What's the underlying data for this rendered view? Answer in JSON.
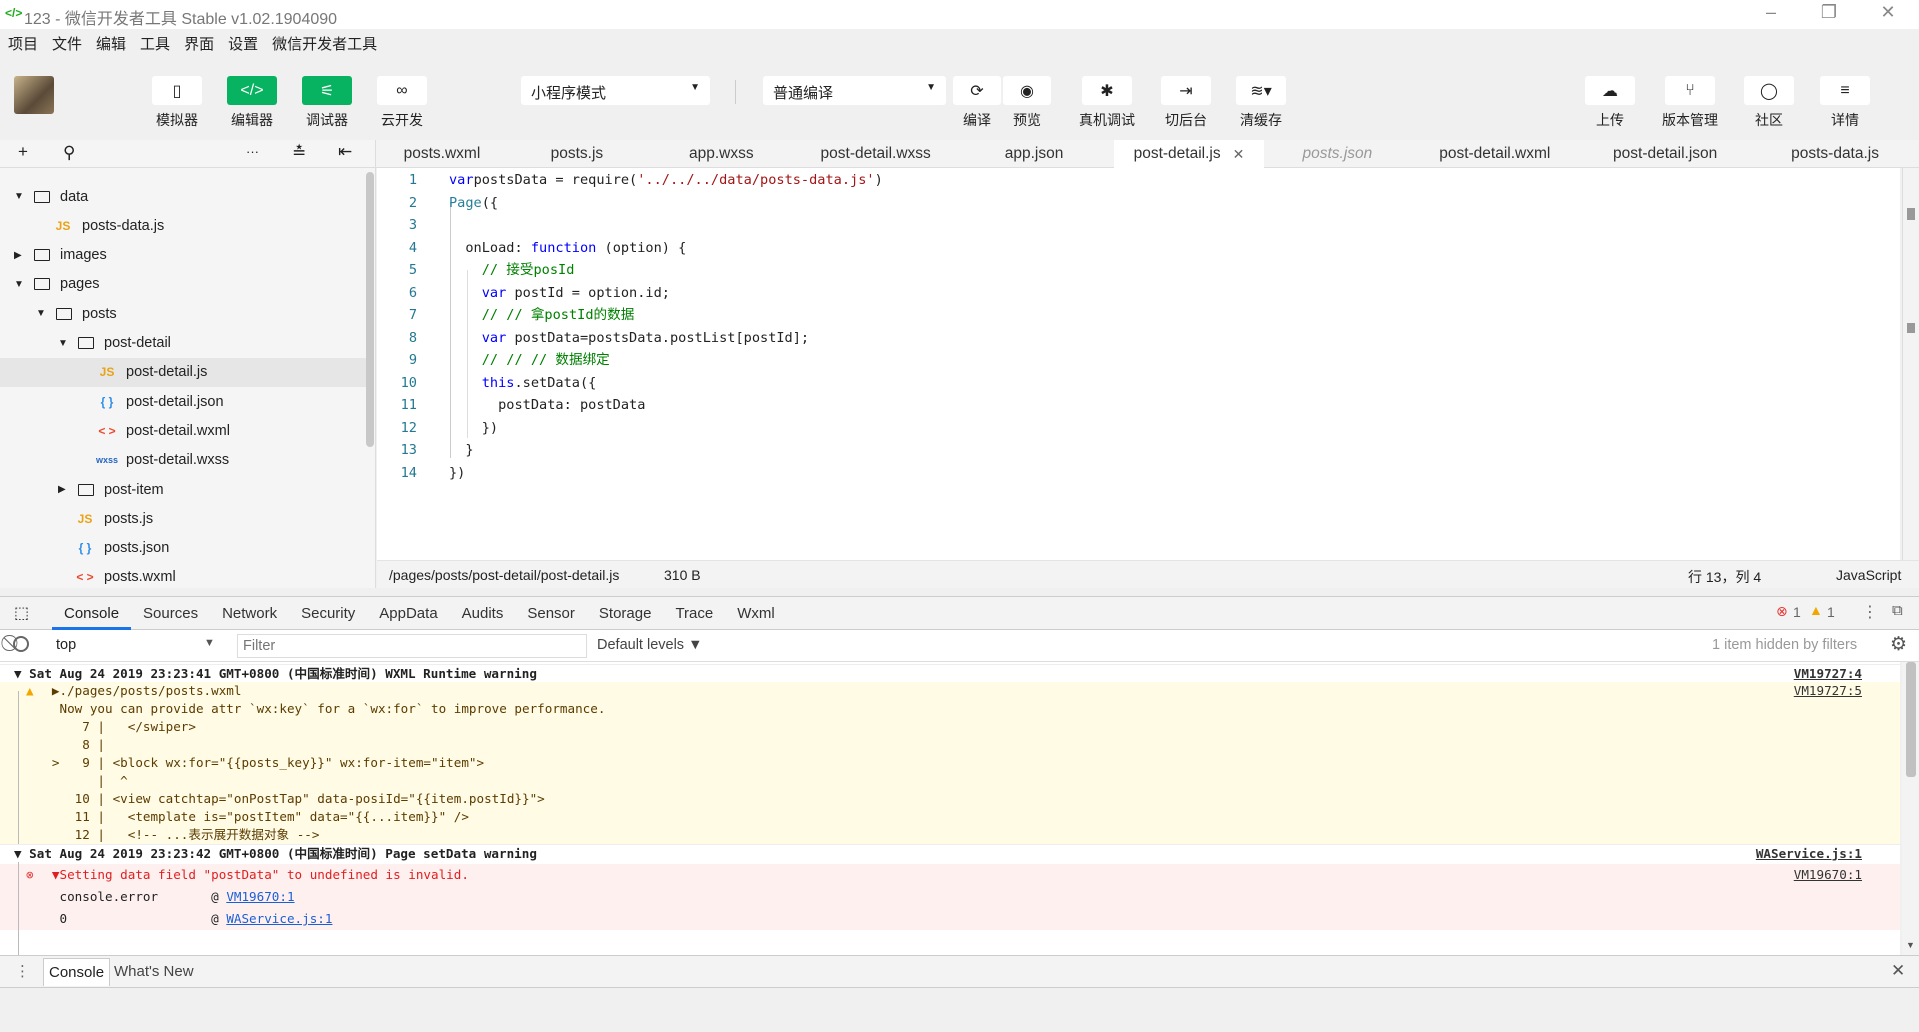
{
  "window": {
    "title": "123 - 微信开发者工具 Stable v1.02.1904090",
    "minimize": "–",
    "restore": "❐",
    "close": "✕"
  },
  "menu": [
    "项目",
    "文件",
    "编辑",
    "工具",
    "界面",
    "设置",
    "微信开发者工具"
  ],
  "toolbar": {
    "left": [
      {
        "label": "模拟器",
        "icon": "phone-icon",
        "glyph": "▯",
        "active": false
      },
      {
        "label": "编辑器",
        "icon": "code-icon",
        "glyph": "</>",
        "active": true
      },
      {
        "label": "调试器",
        "icon": "debug-icon",
        "glyph": "⚟",
        "active": true
      },
      {
        "label": "云开发",
        "icon": "cloud-dev-icon",
        "glyph": "∞",
        "active": false
      }
    ],
    "mode_select": "小程序模式",
    "compile_select": "普通编译",
    "mid": [
      {
        "label": "编译",
        "icon": "refresh-icon",
        "glyph": "⟳"
      },
      {
        "label": "预览",
        "icon": "eye-icon",
        "glyph": "◉"
      },
      {
        "label": "真机调试",
        "icon": "bug-icon",
        "glyph": "✱"
      },
      {
        "label": "切后台",
        "icon": "switch-background-icon",
        "glyph": "⇥"
      },
      {
        "label": "清缓存",
        "icon": "layers-icon",
        "glyph": "≋▾"
      }
    ],
    "right": [
      {
        "label": "上传",
        "icon": "upload-cloud-icon",
        "glyph": "☁"
      },
      {
        "label": "版本管理",
        "icon": "branch-icon",
        "glyph": "⑂"
      },
      {
        "label": "社区",
        "icon": "chat-icon",
        "glyph": "◯"
      },
      {
        "label": "详情",
        "icon": "menu-icon",
        "glyph": "≡"
      }
    ]
  },
  "sidebar": {
    "tools": {
      "add": "+",
      "search": "⚲",
      "more": "···",
      "outline": "≛",
      "collapse": "⇤"
    },
    "tree": [
      {
        "label": "data",
        "type": "folder",
        "level": 0,
        "open": true
      },
      {
        "label": "posts-data.js",
        "type": "js",
        "level": 1
      },
      {
        "label": "images",
        "type": "folder",
        "level": 0,
        "open": false
      },
      {
        "label": "pages",
        "type": "folder",
        "level": 0,
        "open": true
      },
      {
        "label": "posts",
        "type": "folder",
        "level": 1,
        "open": true
      },
      {
        "label": "post-detail",
        "type": "folder",
        "level": 2,
        "open": true
      },
      {
        "label": "post-detail.js",
        "type": "js",
        "level": 3,
        "selected": true
      },
      {
        "label": "post-detail.json",
        "type": "json",
        "level": 3
      },
      {
        "label": "post-detail.wxml",
        "type": "wxml",
        "level": 3
      },
      {
        "label": "post-detail.wxss",
        "type": "wxss",
        "level": 3
      },
      {
        "label": "post-item",
        "type": "folder",
        "level": 2,
        "open": false
      },
      {
        "label": "posts.js",
        "type": "js",
        "level": 2
      },
      {
        "label": "posts.json",
        "type": "json",
        "level": 2
      },
      {
        "label": "posts.wxml",
        "type": "wxml",
        "level": 2
      }
    ],
    "file_icons": {
      "js": "JS",
      "json": "{ }",
      "wxml": "< >",
      "wxss": "wxss"
    },
    "icon_colors": {
      "js": "#e8a317",
      "json": "#2f8ee8",
      "wxml": "#e8482e",
      "wxss": "#2565c2"
    }
  },
  "tabs": [
    {
      "label": "posts.wxml"
    },
    {
      "label": "posts.js"
    },
    {
      "label": "app.wxss"
    },
    {
      "label": "post-detail.wxss"
    },
    {
      "label": "app.json"
    },
    {
      "label": "post-detail.js",
      "active": true,
      "close": "✕"
    },
    {
      "label": "posts.json",
      "preview": true
    },
    {
      "label": "post-detail.wxml"
    },
    {
      "label": "post-detail.json"
    },
    {
      "label": "posts-data.js"
    }
  ],
  "editor": {
    "lines": [
      [
        [
          "kw",
          "var"
        ],
        [
          "",
          "postsData = require("
        ],
        [
          "str",
          "'../../../data/posts-data.js'"
        ],
        [
          "",
          ")"
        ]
      ],
      [
        [
          "fn",
          "Page"
        ],
        [
          "",
          "({"
        ]
      ],
      [],
      [
        [
          "",
          "  onLoad: "
        ],
        [
          "kw",
          "function"
        ],
        [
          "",
          " (option) {"
        ]
      ],
      [
        [
          "cm",
          "    // 接受posId"
        ]
      ],
      [
        [
          "kw",
          "    var"
        ],
        [
          "",
          " postId = option.id;"
        ]
      ],
      [
        [
          "cm",
          "    // // 拿postId的数据"
        ]
      ],
      [
        [
          "kw",
          "    var"
        ],
        [
          "",
          " postData=postsData.postList[postId];"
        ]
      ],
      [
        [
          "cm",
          "    // // // 数据绑定"
        ]
      ],
      [
        [
          "kw",
          "    this"
        ],
        [
          "",
          ".setData({"
        ]
      ],
      [
        [
          "",
          "      postData: postData"
        ]
      ],
      [
        [
          "",
          "    })"
        ]
      ],
      [
        [
          "",
          "  }"
        ]
      ],
      [
        [
          "",
          "})"
        ]
      ]
    ]
  },
  "status": {
    "path": "/pages/posts/post-detail/post-detail.js",
    "size": "310 B",
    "position": "行 13，列 4",
    "language": "JavaScript"
  },
  "devtools": {
    "tabs": [
      "Console",
      "Sources",
      "Network",
      "Security",
      "AppData",
      "Audits",
      "Sensor",
      "Storage",
      "Trace",
      "Wxml"
    ],
    "active_tab": "Console",
    "error_count": "1",
    "warning_count": "1",
    "context": "top",
    "filter_placeholder": "Filter",
    "levels": "Default levels ▼",
    "hidden": "1 item hidden by filters"
  },
  "console": [
    {
      "kind": "hdr",
      "text": "▼ Sat Aug 24 2019 23:23:41 GMT+0800 (中国标准时间) WXML Runtime warning",
      "src": "VM19727:4"
    },
    {
      "kind": "warn",
      "text": "     ▶./pages/posts/posts.wxml",
      "src": "VM19727:5",
      "icon": true
    },
    {
      "kind": "warn",
      "text": "      Now you can provide attr `wx:key` for a `wx:for` to improve performance."
    },
    {
      "kind": "warn",
      "text": "         7 |   </swiper>"
    },
    {
      "kind": "warn",
      "text": "         8 |"
    },
    {
      "kind": "warn",
      "text": "     >   9 | <block wx:for=\"{{posts_key}}\" wx:for-item=\"item\">"
    },
    {
      "kind": "warn",
      "text": "           |  ^"
    },
    {
      "kind": "warn",
      "text": "        10 | <view catchtap=\"onPostTap\" data-posiId=\"{{item.postId}}\">"
    },
    {
      "kind": "warn",
      "text": "        11 |   <template is=\"postItem\" data=\"{{...item}}\" />"
    },
    {
      "kind": "warn",
      "text": "        12 |   <!-- ...表示展开数据对象 -->"
    },
    {
      "kind": "hdr",
      "text": "▼ Sat Aug 24 2019 23:23:42 GMT+0800 (中国标准时间) Page setData warning",
      "src": "WAService.js:1"
    },
    {
      "kind": "err",
      "text": "     ▼Setting data field \"postData\" to undefined is invalid.",
      "src": "VM19670:1",
      "icon": true
    },
    {
      "kind": "errtrace",
      "text": "      console.error       @ ",
      "link": "VM19670:1"
    },
    {
      "kind": "errtrace",
      "text": "      0                   @ ",
      "link": "WAService.js:1"
    }
  ],
  "drawer": {
    "tabs": [
      "Console",
      "What's New"
    ],
    "close": "✕"
  }
}
